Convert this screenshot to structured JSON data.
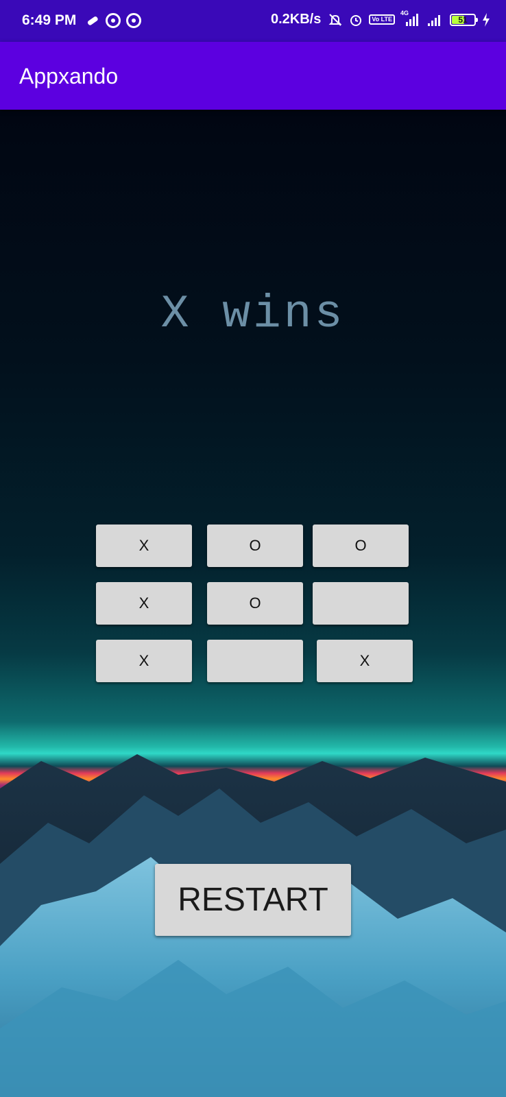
{
  "status_bar": {
    "time": "6:49 PM",
    "left_icons": [
      "bandage-icon",
      "sync-ring-icon",
      "sync-ring-icon"
    ],
    "net_speed": "0.2KB/s",
    "right_icons": [
      "mute-icon",
      "alarm-icon",
      "volte-icon",
      "signal-4g-icon",
      "signal-icon",
      "battery-icon",
      "charging-icon"
    ],
    "volte_label": "Vo LTE",
    "network_label": "4G",
    "battery_level": "51"
  },
  "app_bar": {
    "title": "Appxando"
  },
  "game": {
    "result": "X wins",
    "board": [
      [
        "x",
        "o",
        "o"
      ],
      [
        "x",
        "o",
        ""
      ],
      [
        "x",
        "",
        "x"
      ]
    ],
    "restart_label": "RESTART"
  },
  "colors": {
    "status_bar": "#3a09b8",
    "app_bar": "#5c00e0",
    "button": "#d8d8d8",
    "result_text": "#6c8fa6"
  }
}
